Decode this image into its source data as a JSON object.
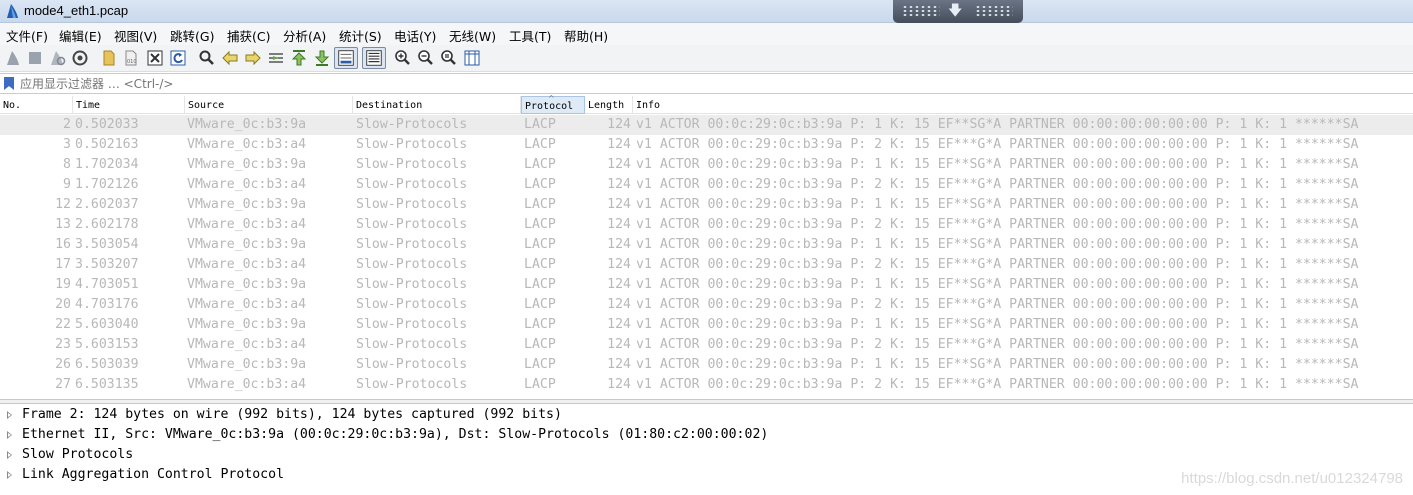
{
  "window": {
    "title": "mode4_eth1.pcap",
    "app_icon": "wireshark-fin-icon"
  },
  "menu": [
    "文件(F)",
    "编辑(E)",
    "视图(V)",
    "跳转(G)",
    "捕获(C)",
    "分析(A)",
    "统计(S)",
    "电话(Y)",
    "无线(W)",
    "工具(T)",
    "帮助(H)"
  ],
  "toolbar": {
    "icons": [
      "start-capture-icon",
      "stop-capture-icon",
      "restart-capture-icon",
      "capture-options-icon",
      "open-file-icon",
      "save-file-icon",
      "close-file-icon",
      "reload-file-icon",
      "find-packet-icon",
      "go-back-icon",
      "go-forward-icon",
      "go-to-packet-icon",
      "first-packet-icon",
      "last-packet-icon",
      "auto-scroll-icon",
      "colorize-icon",
      "zoom-in-icon",
      "zoom-out-icon",
      "zoom-normal-icon",
      "resize-columns-icon"
    ]
  },
  "filter": {
    "placeholder": "应用显示过滤器 … <Ctrl-/>",
    "value": ""
  },
  "columns": [
    "No.",
    "Time",
    "Source",
    "Destination",
    "Protocol",
    "Length",
    "Info"
  ],
  "sorted_column": "Protocol",
  "packets": [
    {
      "no": "2",
      "time": "0.502033",
      "source": "VMware_0c:b3:9a",
      "destination": "Slow-Protocols",
      "protocol": "LACP",
      "length": "124",
      "info": "v1 ACTOR 00:0c:29:0c:b3:9a P: 1 K: 15 EF**SG*A PARTNER 00:00:00:00:00:00 P: 1 K: 1 ******SA"
    },
    {
      "no": "3",
      "time": "0.502163",
      "source": "VMware_0c:b3:a4",
      "destination": "Slow-Protocols",
      "protocol": "LACP",
      "length": "124",
      "info": "v1 ACTOR 00:0c:29:0c:b3:9a P: 2 K: 15 EF***G*A PARTNER 00:00:00:00:00:00 P: 1 K: 1 ******SA"
    },
    {
      "no": "8",
      "time": "1.702034",
      "source": "VMware_0c:b3:9a",
      "destination": "Slow-Protocols",
      "protocol": "LACP",
      "length": "124",
      "info": "v1 ACTOR 00:0c:29:0c:b3:9a P: 1 K: 15 EF**SG*A PARTNER 00:00:00:00:00:00 P: 1 K: 1 ******SA"
    },
    {
      "no": "9",
      "time": "1.702126",
      "source": "VMware_0c:b3:a4",
      "destination": "Slow-Protocols",
      "protocol": "LACP",
      "length": "124",
      "info": "v1 ACTOR 00:0c:29:0c:b3:9a P: 2 K: 15 EF***G*A PARTNER 00:00:00:00:00:00 P: 1 K: 1 ******SA"
    },
    {
      "no": "12",
      "time": "2.602037",
      "source": "VMware_0c:b3:9a",
      "destination": "Slow-Protocols",
      "protocol": "LACP",
      "length": "124",
      "info": "v1 ACTOR 00:0c:29:0c:b3:9a P: 1 K: 15 EF**SG*A PARTNER 00:00:00:00:00:00 P: 1 K: 1 ******SA"
    },
    {
      "no": "13",
      "time": "2.602178",
      "source": "VMware_0c:b3:a4",
      "destination": "Slow-Protocols",
      "protocol": "LACP",
      "length": "124",
      "info": "v1 ACTOR 00:0c:29:0c:b3:9a P: 2 K: 15 EF***G*A PARTNER 00:00:00:00:00:00 P: 1 K: 1 ******SA"
    },
    {
      "no": "16",
      "time": "3.503054",
      "source": "VMware_0c:b3:9a",
      "destination": "Slow-Protocols",
      "protocol": "LACP",
      "length": "124",
      "info": "v1 ACTOR 00:0c:29:0c:b3:9a P: 1 K: 15 EF**SG*A PARTNER 00:00:00:00:00:00 P: 1 K: 1 ******SA"
    },
    {
      "no": "17",
      "time": "3.503207",
      "source": "VMware_0c:b3:a4",
      "destination": "Slow-Protocols",
      "protocol": "LACP",
      "length": "124",
      "info": "v1 ACTOR 00:0c:29:0c:b3:9a P: 2 K: 15 EF***G*A PARTNER 00:00:00:00:00:00 P: 1 K: 1 ******SA"
    },
    {
      "no": "19",
      "time": "4.703051",
      "source": "VMware_0c:b3:9a",
      "destination": "Slow-Protocols",
      "protocol": "LACP",
      "length": "124",
      "info": "v1 ACTOR 00:0c:29:0c:b3:9a P: 1 K: 15 EF**SG*A PARTNER 00:00:00:00:00:00 P: 1 K: 1 ******SA"
    },
    {
      "no": "20",
      "time": "4.703176",
      "source": "VMware_0c:b3:a4",
      "destination": "Slow-Protocols",
      "protocol": "LACP",
      "length": "124",
      "info": "v1 ACTOR 00:0c:29:0c:b3:9a P: 2 K: 15 EF***G*A PARTNER 00:00:00:00:00:00 P: 1 K: 1 ******SA"
    },
    {
      "no": "22",
      "time": "5.603040",
      "source": "VMware_0c:b3:9a",
      "destination": "Slow-Protocols",
      "protocol": "LACP",
      "length": "124",
      "info": "v1 ACTOR 00:0c:29:0c:b3:9a P: 1 K: 15 EF**SG*A PARTNER 00:00:00:00:00:00 P: 1 K: 1 ******SA"
    },
    {
      "no": "23",
      "time": "5.603153",
      "source": "VMware_0c:b3:a4",
      "destination": "Slow-Protocols",
      "protocol": "LACP",
      "length": "124",
      "info": "v1 ACTOR 00:0c:29:0c:b3:9a P: 2 K: 15 EF***G*A PARTNER 00:00:00:00:00:00 P: 1 K: 1 ******SA"
    },
    {
      "no": "26",
      "time": "6.503039",
      "source": "VMware_0c:b3:9a",
      "destination": "Slow-Protocols",
      "protocol": "LACP",
      "length": "124",
      "info": "v1 ACTOR 00:0c:29:0c:b3:9a P: 1 K: 15 EF**SG*A PARTNER 00:00:00:00:00:00 P: 1 K: 1 ******SA"
    },
    {
      "no": "27",
      "time": "6.503135",
      "source": "VMware_0c:b3:a4",
      "destination": "Slow-Protocols",
      "protocol": "LACP",
      "length": "124",
      "info": "v1 ACTOR 00:0c:29:0c:b3:9a P: 2 K: 15 EF***G*A PARTNER 00:00:00:00:00:00 P: 1 K: 1 ******SA"
    }
  ],
  "selected_packet_index": 0,
  "details": [
    "Frame 2: 124 bytes on wire (992 bits), 124 bytes captured (992 bits)",
    "Ethernet II, Src: VMware_0c:b3:9a (00:0c:29:0c:b3:9a), Dst: Slow-Protocols (01:80:c2:00:00:02)",
    "Slow Protocols",
    "Link Aggregation Control Protocol"
  ],
  "watermark": "https://blog.csdn.net/u012324798",
  "colors": {
    "packet_text": "#b8b8b8",
    "selected_row": "#ececec",
    "sorted_header": "#dfeaf7"
  }
}
